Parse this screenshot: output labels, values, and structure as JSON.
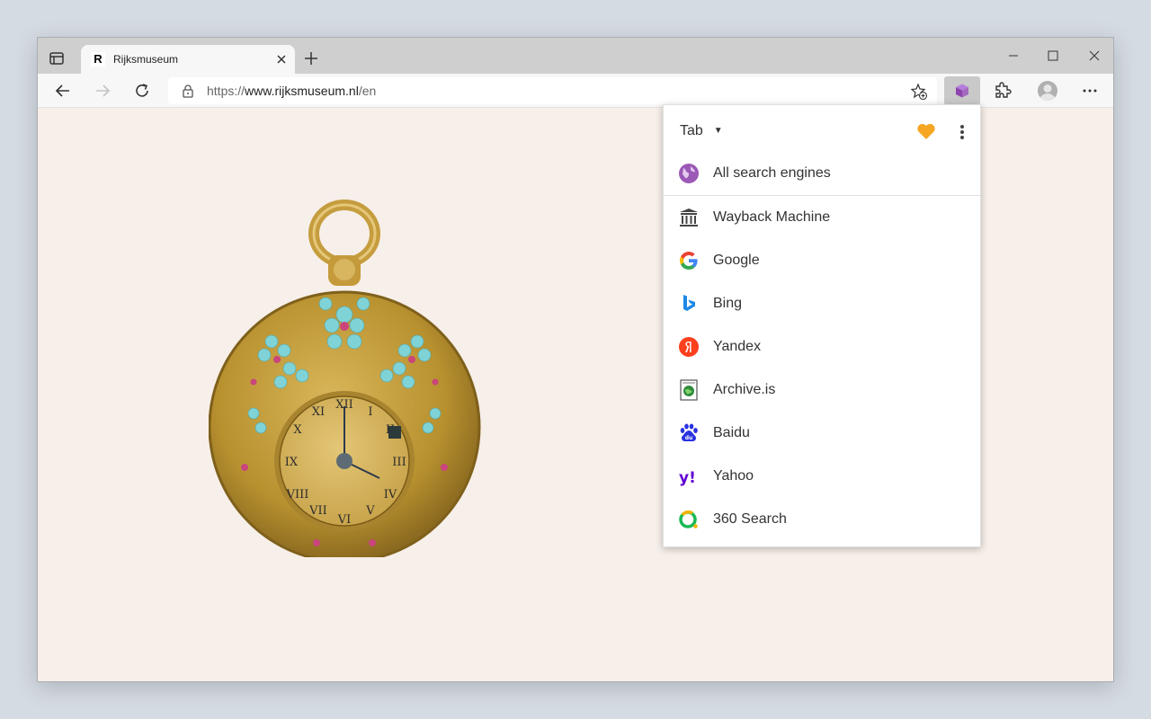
{
  "browser": {
    "tab": {
      "favicon": "R",
      "title": "Rijksmuseum"
    },
    "address": {
      "scheme": "https://",
      "host": "www.rijksmuseum.nl",
      "path": "/en"
    }
  },
  "popup": {
    "target_label": "Tab",
    "engines": [
      {
        "label": "All search engines",
        "icon": "globe-icon"
      },
      {
        "label": "Wayback Machine",
        "icon": "wayback-icon"
      },
      {
        "label": "Google",
        "icon": "google-icon"
      },
      {
        "label": "Bing",
        "icon": "bing-icon"
      },
      {
        "label": "Yandex",
        "icon": "yandex-icon"
      },
      {
        "label": "Archive.is",
        "icon": "archive-is-icon"
      },
      {
        "label": "Baidu",
        "icon": "baidu-icon"
      },
      {
        "label": "Yahoo",
        "icon": "yahoo-icon"
      },
      {
        "label": "360 Search",
        "icon": "360-search-icon"
      }
    ]
  },
  "colors": {
    "accent_purple": "#9b59b6",
    "heart": "#f5a623",
    "page_background": "#f7efe9"
  }
}
